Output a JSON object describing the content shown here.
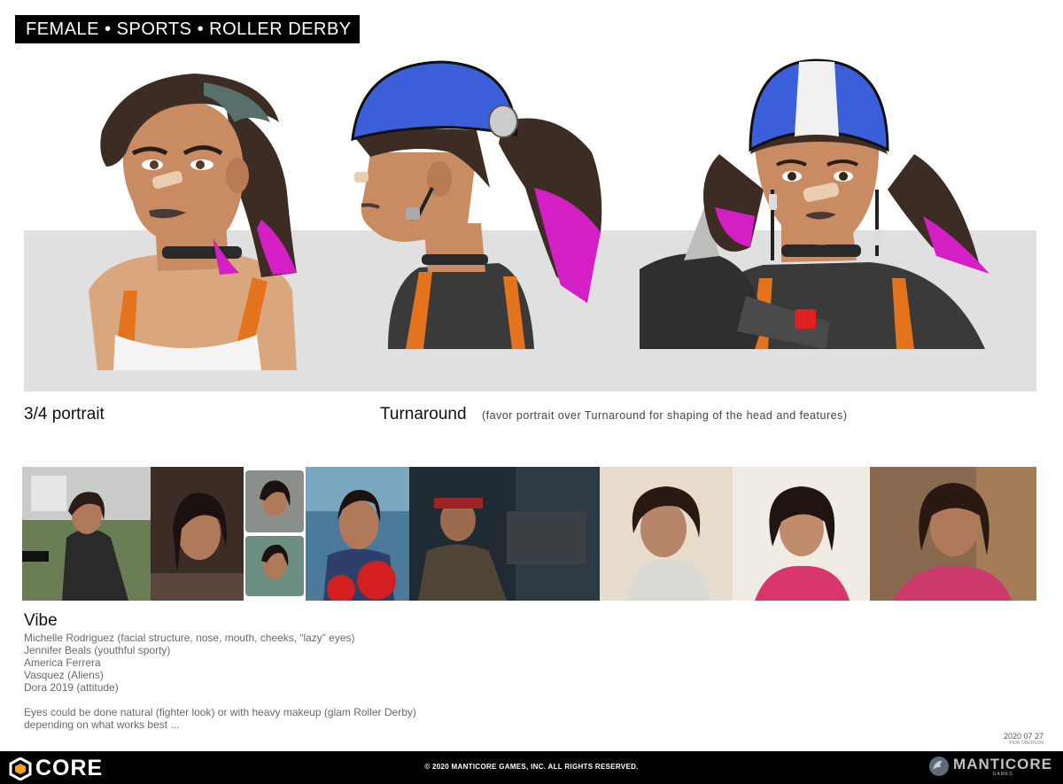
{
  "header": {
    "title": "FEMALE • SPORTS • ROLLER DERBY"
  },
  "sections": {
    "portrait_label": "3/4 portrait",
    "turnaround_label": "Turnaround",
    "turnaround_note": "(favor portrait over Turnaround for shaping of the head and features)"
  },
  "vibe": {
    "title": "Vibe",
    "references": [
      "Michelle Rodriguez (facial structure, nose, mouth, cheeks, “lazy” eyes)",
      "Jennifer Beals (youthful sporty)",
      "America Ferrera",
      "Vasquez (Aliens)",
      "Dora 2019 (attitude)"
    ],
    "note_line1": "Eyes could be done natural (fighter look) or with heavy makeup (glam Roller Derby)",
    "note_line2": "depending on what works best ..."
  },
  "date": {
    "value": "2020 07 27",
    "artist": "PIOR OBERSON"
  },
  "footer": {
    "logo_text": "CORE",
    "copyright": "© 2020 MANTICORE GAMES, INC. ALL RIGHTS RESERVED.",
    "brand_text": "MANTICORE",
    "brand_sub": "GAMES"
  },
  "colors": {
    "hair": "#3d2c24",
    "hair_tip": "#d31fc4",
    "skin": "#c88b62",
    "helmet": "#3a5fd8",
    "strap": "#e3731c",
    "band": "#e0e0e0"
  }
}
